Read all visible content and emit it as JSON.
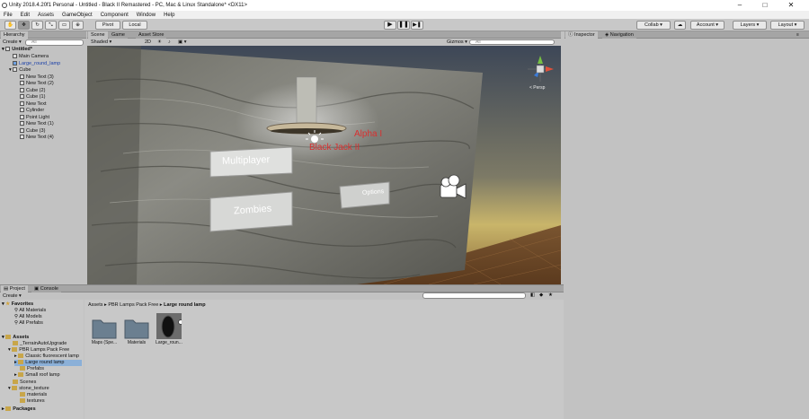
{
  "window": {
    "title": "Unity 2018.4.20f1 Personal - Untitled - Black II Remastered - PC, Mac & Linux Standalone* <DX11>"
  },
  "menu": [
    "File",
    "Edit",
    "Assets",
    "GameObject",
    "Component",
    "Window",
    "Help"
  ],
  "toolbar": {
    "pivot": "Pivot",
    "local": "Local",
    "collab": "Collab",
    "account": "Account",
    "layers": "Layers",
    "layout": "Layout"
  },
  "hierarchy": {
    "tab": "Hierarchy",
    "create": "Create",
    "search_placeholder": "All",
    "scene": "Untitled*",
    "items": [
      "Main Camera",
      "Large_round_lamp",
      "Cube",
      "New Text (3)",
      "New Text (2)",
      "Cube (2)",
      "Cube (1)",
      "New Text",
      "Cylinder",
      "Point Light",
      "New Text (1)",
      "Cube (3)",
      "New Text (4)"
    ]
  },
  "scene_view": {
    "tabs": [
      "Scene",
      "Game",
      "Asset Store"
    ],
    "shading": "Shaded",
    "mode2d": "2D",
    "gizmos": "Gizmos",
    "search_placeholder": "All",
    "persp": "< Persp",
    "labels": {
      "alpha": "Alpha I",
      "blackjack": "Black Jack II",
      "multiplayer": "Multiplayer",
      "zombies": "Zombies",
      "options": "Options"
    }
  },
  "inspector": {
    "tabs": [
      "Inspector",
      "Navigation"
    ]
  },
  "project": {
    "tabs": [
      "Project",
      "Console"
    ],
    "create": "Create",
    "favorites": {
      "label": "Favorites",
      "items": [
        "All Materials",
        "All Models",
        "All Prefabs"
      ]
    },
    "assets": {
      "label": "Assets",
      "items": [
        "_TerrainAutoUpgrade",
        "PBR Lamps Pack Free",
        "Classic fluorescent lamp",
        "Large round lamp",
        "Prefabs",
        "Small roof lamp",
        "Scenes",
        "stone_texture",
        "materials",
        "textures"
      ]
    },
    "packages": "Packages",
    "breadcrumb": [
      "Assets",
      "PBR Lamps Pack Free",
      "Large round lamp"
    ],
    "files": [
      "Maps (Spe...",
      "Materials",
      "Large_roun..."
    ]
  }
}
